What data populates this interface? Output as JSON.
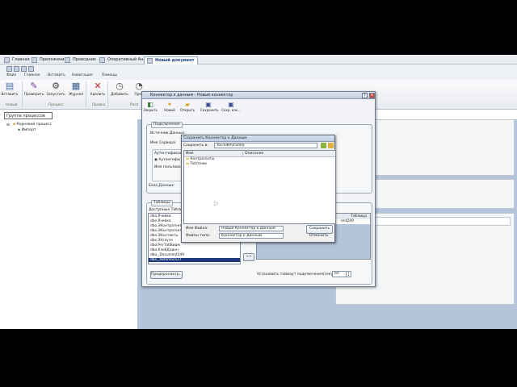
{
  "doc_tabs": [
    "Главная",
    "Приложения",
    "Проводник",
    "Оперативный Анализ",
    "Новый документ"
  ],
  "ribbon_tabs": [
    "Файл",
    "Главное",
    "Вставить",
    "Навигация",
    "Помощь"
  ],
  "ribbon_buttons": [
    "Вставить",
    "Проверить",
    "Запустить",
    "Журнал",
    "Удалить",
    "Добавить",
    "Прев"
  ],
  "ribbon_icons": [
    "paste-icon",
    "check-icon",
    "gear-icon",
    "journal-icon",
    "delete-icon",
    "add-icon",
    "preview-icon"
  ],
  "ribbon_groups": [
    "Новый",
    "Процесс",
    "Правка",
    "Расп"
  ],
  "process_panel": {
    "title": "Группа процессов",
    "root": "Корневой процесс",
    "child": "Импорт"
  },
  "dialog1": {
    "title": "Коннектор к данным - Новый коннектор",
    "toolbar": [
      "Закрыть",
      "Новый",
      "Открыть",
      "Сохранить",
      "Сохр. как..."
    ],
    "connection": {
      "legend": "Подключение",
      "source_label": "Источник Данных:",
      "server_label": "Имя Сервера:",
      "auth_label": "Аутентификация",
      "auth_option": "Аутентифи",
      "user_label": "Имя пользоват",
      "db_label": "База Данных:"
    },
    "tables": {
      "legend": "Таблицы",
      "available_label": "Доступные Таблиц",
      "items": [
        "dbo.Ячейки",
        "dbo.Ячейка",
        "dbo.ЭКонтрагент",
        "dbo.ЭКонтрагент",
        "dbo.ЭКонтакты",
        "dbo.ЭУслуги",
        "dbo.РегТабВидм",
        "dbo.ХлебДлинн",
        "dbo._Document249",
        "dbo._Reference37"
      ],
      "selected_item": "dbo._Reference37",
      "right_header": "Таблица",
      "right_item": "ent249",
      "move_back_button": "<<",
      "preview_button": "Предпросмотр...",
      "timeout_label": "Установить таймаут подключения(секунды):",
      "timeout_value": "60"
    }
  },
  "dialog2": {
    "title": "Сохранить Коннектор к Данным",
    "save_in_label": "Сохранить в:",
    "save_in_value": "YouTube\\Iconka",
    "col_name": "Имя",
    "col_desc": "Описание",
    "folders": [
      "Контрагенты",
      "Платежи"
    ],
    "file_name_label": "Имя Файла:",
    "file_name_value": "Новый Коннектор к Данным",
    "file_type_label": "Файлы типа:",
    "file_type_value": "Коннектор к Данным",
    "save_button": "Сохранить",
    "cancel_button": "Отменить"
  },
  "colors": {
    "designer_bg": "#b4c4db",
    "selection": "#1f3a7a"
  }
}
